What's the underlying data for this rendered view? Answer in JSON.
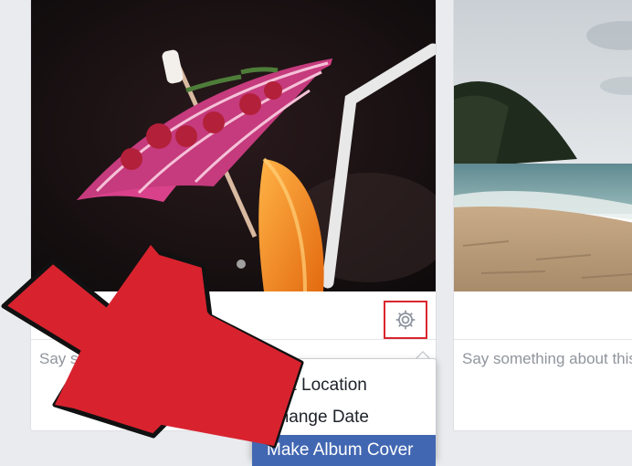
{
  "photos": [
    {
      "caption_placeholder": "Say something about this photo...",
      "settings_icon": "gear-icon",
      "menu": {
        "items": [
          {
            "label": "Edit Location",
            "highlighted": false
          },
          {
            "label": "Change Date",
            "highlighted": false
          },
          {
            "label": "Make Album Cover",
            "highlighted": true
          }
        ]
      }
    },
    {
      "caption_placeholder": "Say something about this photo..."
    }
  ],
  "colors": {
    "highlight_box": "#d9262e",
    "menu_highlight": "#4267b2",
    "instruction_arrow": "#d8232f"
  }
}
